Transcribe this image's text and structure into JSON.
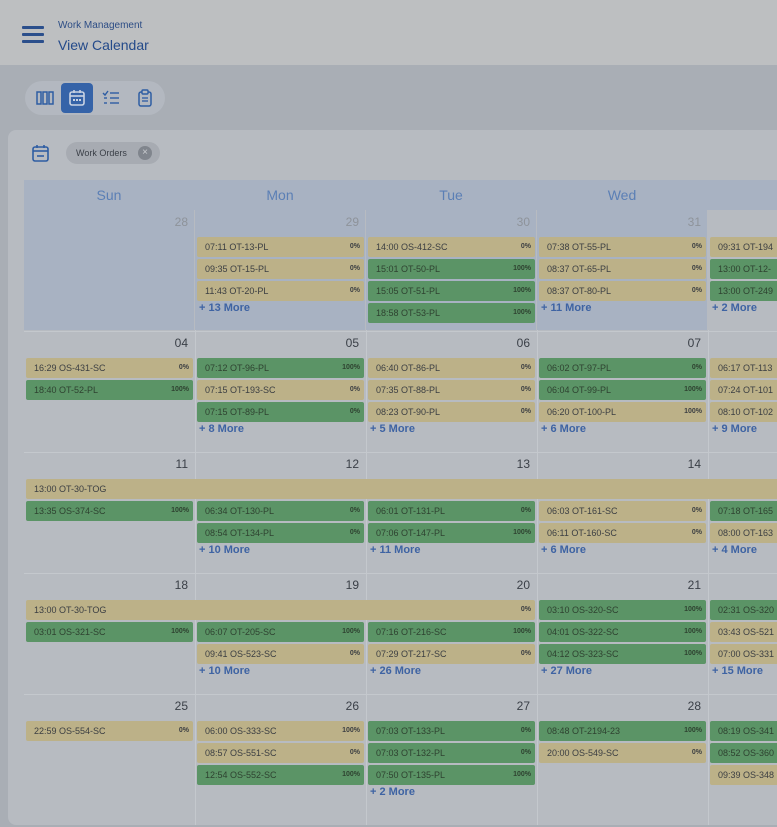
{
  "header": {
    "breadcrumb": "Work Management",
    "title": "View Calendar"
  },
  "view_buttons": [
    {
      "name": "columns-view-icon",
      "active": false
    },
    {
      "name": "calendar-view-icon",
      "active": true
    },
    {
      "name": "list-view-icon",
      "active": false
    },
    {
      "name": "clipboard-view-icon",
      "active": false
    }
  ],
  "filter": {
    "chip_label": "Work Orders",
    "close_symbol": "×"
  },
  "days": [
    "Sun",
    "Mon",
    "Tue",
    "Wed"
  ],
  "weeks": [
    {
      "cells": [
        {
          "num": "28",
          "muted": true,
          "events": [],
          "more": ""
        },
        {
          "num": "29",
          "muted": true,
          "events": [
            {
              "t": "07:11 OT-13-PL",
              "p": "0%",
              "c": "y"
            },
            {
              "t": "09:35 OT-15-PL",
              "p": "0%",
              "c": "y"
            },
            {
              "t": "11:43 OT-20-PL",
              "p": "0%",
              "c": "y"
            }
          ],
          "more": "+ 13 More"
        },
        {
          "num": "30",
          "muted": true,
          "events": [
            {
              "t": "14:00 OS-412-SC",
              "p": "0%",
              "c": "y"
            },
            {
              "t": "15:01 OT-50-PL",
              "p": "100%",
              "c": "g"
            },
            {
              "t": "15:05 OT-51-PL",
              "p": "100%",
              "c": "g"
            },
            {
              "t": "18:58 OT-53-PL",
              "p": "100%",
              "c": "g"
            }
          ],
          "more": ""
        },
        {
          "num": "31",
          "muted": true,
          "events": [
            {
              "t": "07:38 OT-55-PL",
              "p": "0%",
              "c": "y"
            },
            {
              "t": "08:37 OT-65-PL",
              "p": "0%",
              "c": "y"
            },
            {
              "t": "08:37 OT-80-PL",
              "p": "0%",
              "c": "y"
            }
          ],
          "more": "+ 11 More"
        },
        {
          "num": "",
          "muted": true,
          "events": [
            {
              "t": "09:31 OT-194",
              "p": "",
              "c": "y"
            },
            {
              "t": "13:00 OT-12-",
              "p": "",
              "c": "g"
            },
            {
              "t": "13:00 OT-249",
              "p": "",
              "c": "g"
            }
          ],
          "more": "+ 2 More"
        }
      ]
    },
    {
      "cells": [
        {
          "num": "04",
          "muted": false,
          "events": [
            {
              "t": "16:29 OS-431-SC",
              "p": "0%",
              "c": "y"
            },
            {
              "t": "18:40 OT-52-PL",
              "p": "100%",
              "c": "g"
            }
          ],
          "more": ""
        },
        {
          "num": "05",
          "muted": false,
          "events": [
            {
              "t": "07:12 OT-96-PL",
              "p": "100%",
              "c": "g"
            },
            {
              "t": "07:15 OT-193-SC",
              "p": "0%",
              "c": "y"
            },
            {
              "t": "07:15 OT-89-PL",
              "p": "0%",
              "c": "g"
            }
          ],
          "more": "+ 8 More"
        },
        {
          "num": "06",
          "muted": false,
          "events": [
            {
              "t": "06:40 OT-86-PL",
              "p": "0%",
              "c": "y"
            },
            {
              "t": "07:35 OT-88-PL",
              "p": "0%",
              "c": "y"
            },
            {
              "t": "08:23 OT-90-PL",
              "p": "0%",
              "c": "y"
            }
          ],
          "more": "+ 5 More"
        },
        {
          "num": "07",
          "muted": false,
          "events": [
            {
              "t": "06:02 OT-97-PL",
              "p": "0%",
              "c": "g"
            },
            {
              "t": "06:04 OT-99-PL",
              "p": "100%",
              "c": "g"
            },
            {
              "t": "06:20 OT-100-PL",
              "p": "100%",
              "c": "y"
            }
          ],
          "more": "+ 6 More"
        },
        {
          "num": "",
          "muted": false,
          "events": [
            {
              "t": "06:17 OT-113",
              "p": "",
              "c": "y"
            },
            {
              "t": "07:24 OT-101",
              "p": "",
              "c": "y"
            },
            {
              "t": "08:10 OT-102",
              "p": "",
              "c": "y"
            }
          ],
          "more": "+ 9 More"
        }
      ]
    },
    {
      "span": {
        "t": "13:00 OT-30-TOG",
        "p": ""
      },
      "cells": [
        {
          "num": "11",
          "muted": false,
          "events": [
            {
              "t": "13:35 OS-374-SC",
              "p": "100%",
              "c": "g"
            }
          ],
          "more": ""
        },
        {
          "num": "12",
          "muted": false,
          "events": [
            {
              "t": "06:34 OT-130-PL",
              "p": "0%",
              "c": "g"
            },
            {
              "t": "08:54 OT-134-PL",
              "p": "0%",
              "c": "g"
            }
          ],
          "more": "+ 10 More"
        },
        {
          "num": "13",
          "muted": false,
          "events": [
            {
              "t": "06:01 OT-131-PL",
              "p": "0%",
              "c": "g"
            },
            {
              "t": "07:06 OT-147-PL",
              "p": "100%",
              "c": "g"
            }
          ],
          "more": "+ 11 More"
        },
        {
          "num": "14",
          "muted": false,
          "events": [
            {
              "t": "06:03 OT-161-SC",
              "p": "0%",
              "c": "y"
            },
            {
              "t": "06:11 OT-160-SC",
              "p": "0%",
              "c": "y"
            }
          ],
          "more": "+ 6 More"
        },
        {
          "num": "",
          "muted": false,
          "events": [
            {
              "t": "07:18 OT-165",
              "p": "",
              "c": "g"
            },
            {
              "t": "08:00 OT-163",
              "p": "",
              "c": "y"
            }
          ],
          "more": "+ 4 More"
        }
      ]
    },
    {
      "span": {
        "t": "13:00 OT-30-TOG",
        "p": "0%"
      },
      "cells": [
        {
          "num": "18",
          "muted": false,
          "events": [
            {
              "t": "03:01 OS-321-SC",
              "p": "100%",
              "c": "g"
            }
          ],
          "more": ""
        },
        {
          "num": "19",
          "muted": false,
          "events": [
            {
              "t": "06:07 OT-205-SC",
              "p": "100%",
              "c": "g"
            },
            {
              "t": "09:41 OS-523-SC",
              "p": "0%",
              "c": "y"
            }
          ],
          "more": "+ 10 More"
        },
        {
          "num": "20",
          "muted": false,
          "events": [
            {
              "t": "07:16 OT-216-SC",
              "p": "100%",
              "c": "g"
            },
            {
              "t": "07:29 OT-217-SC",
              "p": "0%",
              "c": "y"
            }
          ],
          "more": "+ 26 More"
        },
        {
          "num": "21",
          "muted": false,
          "firstInRow": true,
          "events": [
            {
              "t": "03:10 OS-320-SC",
              "p": "100%",
              "c": "g"
            },
            {
              "t": "04:01 OS-322-SC",
              "p": "100%",
              "c": "g"
            },
            {
              "t": "04:12 OS-323-SC",
              "p": "100%",
              "c": "g"
            }
          ],
          "more": "+ 27 More"
        },
        {
          "num": "",
          "muted": false,
          "firstInRow": true,
          "events": [
            {
              "t": "02:31 OS-320",
              "p": "",
              "c": "g"
            },
            {
              "t": "03:43 OS-521",
              "p": "",
              "c": "y"
            },
            {
              "t": "07:00 OS-331",
              "p": "",
              "c": "y"
            }
          ],
          "more": "+ 15 More"
        }
      ]
    },
    {
      "cells": [
        {
          "num": "25",
          "muted": false,
          "events": [
            {
              "t": "22:59 OS-554-SC",
              "p": "0%",
              "c": "y"
            }
          ],
          "more": ""
        },
        {
          "num": "26",
          "muted": false,
          "events": [
            {
              "t": "06:00 OS-333-SC",
              "p": "100%",
              "c": "y"
            },
            {
              "t": "08:57 OS-551-SC",
              "p": "0%",
              "c": "y"
            },
            {
              "t": "12:54 OS-552-SC",
              "p": "100%",
              "c": "g"
            }
          ],
          "more": ""
        },
        {
          "num": "27",
          "muted": false,
          "events": [
            {
              "t": "07:03 OT-133-PL",
              "p": "0%",
              "c": "g"
            },
            {
              "t": "07:03 OT-132-PL",
              "p": "0%",
              "c": "g"
            },
            {
              "t": "07:50 OT-135-PL",
              "p": "100%",
              "c": "g"
            }
          ],
          "more": "+ 2 More"
        },
        {
          "num": "28",
          "muted": false,
          "events": [
            {
              "t": "08:48 OT-2194-23",
              "p": "100%",
              "c": "g"
            },
            {
              "t": "20:00 OS-549-SC",
              "p": "0%",
              "c": "y"
            }
          ],
          "more": ""
        },
        {
          "num": "",
          "muted": false,
          "events": [
            {
              "t": "08:19 OS-341",
              "p": "",
              "c": "g"
            },
            {
              "t": "08:52 OS-360",
              "p": "",
              "c": "g"
            },
            {
              "t": "09:39 OS-348",
              "p": "",
              "c": "y"
            }
          ],
          "more": ""
        }
      ]
    }
  ],
  "colors": {
    "pending": "#bcb188",
    "done": "#5b9466",
    "link": "#3e63a3",
    "accent": "#3563a8"
  }
}
